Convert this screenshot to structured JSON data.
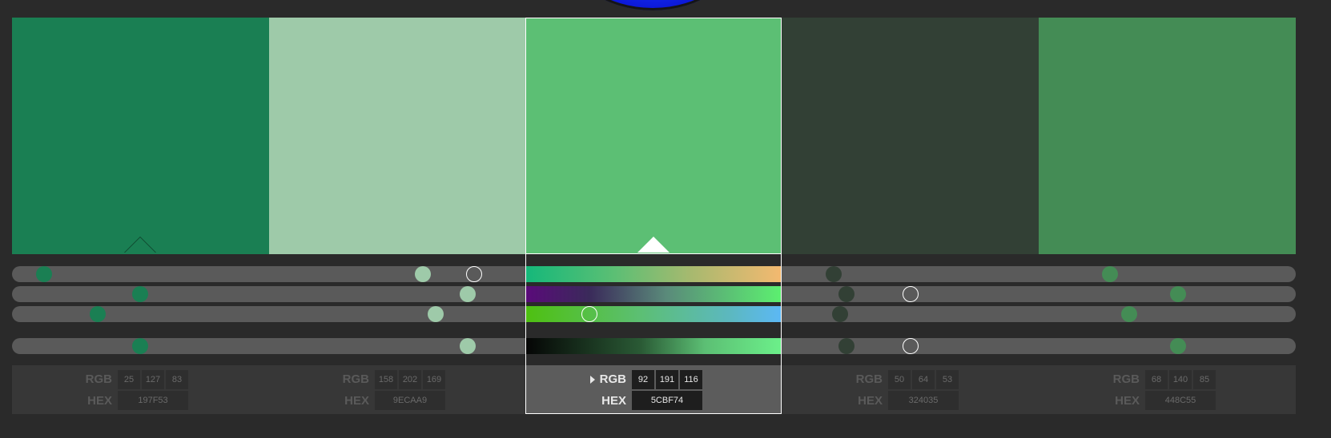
{
  "palette": {
    "active_index": 2,
    "swatches": [
      {
        "color": "#1A7F53",
        "rgb_label": "RGB",
        "hex_label": "HEX",
        "r": "25",
        "g": "127",
        "b": "83",
        "hex": "197F53",
        "slider_values": {
          "hue": 0.025,
          "saturation": 0.1,
          "lightness": 0.067,
          "brightness": 0.1
        }
      },
      {
        "color": "#9ECAA9",
        "rgb_label": "RGB",
        "hex_label": "HEX",
        "r": "158",
        "g": "202",
        "b": "169",
        "hex": "9ECAA9",
        "slider_values": {
          "hue": 0.32,
          "saturation": 0.355,
          "lightness": 0.33,
          "brightness": 0.355
        }
      },
      {
        "color": "#5CBF74",
        "rgb_label": "RGB",
        "hex_label": "HEX",
        "r": "92",
        "g": "191",
        "b": "116",
        "hex": "5CBF74",
        "slider_values": {
          "hue": 0.36,
          "saturation": 0.7,
          "lightness": 0.45,
          "brightness": 0.7
        }
      },
      {
        "color": "#324035",
        "rgb_label": "RGB",
        "hex_label": "HEX",
        "r": "50",
        "g": "64",
        "b": "53",
        "hex": "324035",
        "slider_values": {
          "hue": 0.64,
          "saturation": 0.65,
          "lightness": 0.645,
          "brightness": 0.65
        }
      },
      {
        "color": "#448C55",
        "rgb_label": "RGB",
        "hex_label": "HEX",
        "r": "68",
        "g": "140",
        "b": "85",
        "hex": "448C55",
        "slider_values": {
          "hue": 0.855,
          "saturation": 0.908,
          "lightness": 0.87,
          "brightness": 0.908
        }
      }
    ],
    "active_strip_gradients": [
      "linear-gradient(90deg, #15b87a, #5cbf74 35%, #a8b96f 65%, #f4b970)",
      "linear-gradient(90deg, #5a0a7a, #3a2a5a 25%, #5a8a7a 55%, #5cf070)",
      "linear-gradient(90deg, #4ec010, #5cbf74 45%, #5cb8c0 80%, #5cb8f5)",
      "linear-gradient(90deg, #050505, #2a5a35 45%, #5cbf74 70%, #6cf08a)"
    ]
  }
}
